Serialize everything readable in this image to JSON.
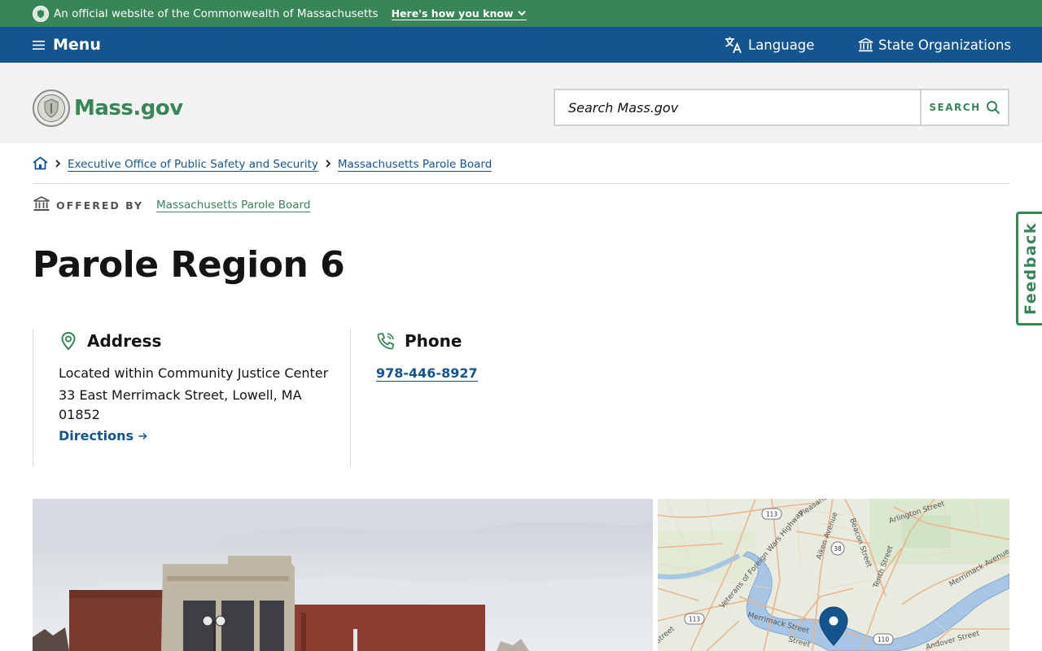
{
  "banner": {
    "text": "An official website of the Commonwealth of Massachusetts",
    "how_label": "Here's how you know"
  },
  "utility": {
    "menu_label": "Menu",
    "language_label": "Language",
    "orgs_label": "State Organizations"
  },
  "header": {
    "logo_text": "Mass.gov",
    "search_placeholder": "Search Mass.gov",
    "search_button": "SEARCH"
  },
  "breadcrumb": {
    "items": [
      "Executive Office of Public Safety and Security",
      "Massachusetts Parole Board"
    ]
  },
  "offered_by": {
    "label": "OFFERED BY",
    "org": "Massachusetts Parole Board"
  },
  "page": {
    "title": "Parole Region 6"
  },
  "address": {
    "heading": "Address",
    "name": "Located within Community Justice Center",
    "street": "33 East Merrimack Street, Lowell, MA",
    "zip": "01852",
    "directions": "Directions"
  },
  "phone": {
    "heading": "Phone",
    "number": "978-446-8927"
  },
  "map": {
    "labels": {
      "route113a": "113",
      "route38": "38",
      "route113b": "113",
      "route110": "110",
      "pleasant": "Pleasant",
      "arlington": "Arlington Street",
      "aiken": "Aiken Avenue",
      "beacon": "Beacon Street",
      "tenth": "Tenth Street",
      "merrimack_ave": "Merrimack Avenue",
      "vfw": "Veterans of Foreign Wars Highway",
      "merrimack_st": "Merrimack Street",
      "andover": "Andover Street",
      "street_sw": "Street",
      "street_s": "Street"
    }
  },
  "feedback": {
    "label": "Feedback"
  },
  "colors": {
    "green": "#388557",
    "blue": "#14558f",
    "header_bg": "#f2f2f2"
  }
}
